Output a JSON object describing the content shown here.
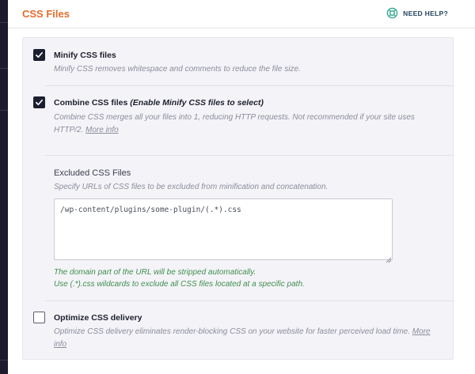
{
  "section": {
    "title": "CSS Files",
    "help_label": "NEED HELP?"
  },
  "colors": {
    "accent": "#e36b2c",
    "help": "#22465e",
    "note_green": "#3f8f4e",
    "checkbox": "#1b1f2f"
  },
  "options": {
    "minify": {
      "label": "Minify CSS files",
      "checked": true,
      "description": "Minify CSS removes whitespace and comments to reduce the file size."
    },
    "combine": {
      "label": "Combine CSS files",
      "hint": "(Enable Minify CSS files to select)",
      "checked": true,
      "description": "Combine CSS merges all your files into 1, reducing HTTP requests. Not recommended if your site uses HTTP/2.",
      "more_info": "More info"
    },
    "excluded": {
      "title": "Excluded CSS Files",
      "description": "Specify URLs of CSS files to be excluded from minification and concatenation.",
      "value": "/wp-content/plugins/some-plugin/(.*).css",
      "note_1": "The domain part of the URL will be stripped automatically.",
      "note_2": "Use (.*).css wildcards to exclude all CSS files located at a specific path."
    },
    "optimize": {
      "label": "Optimize CSS delivery",
      "checked": false,
      "description": "Optimize CSS delivery eliminates render-blocking CSS on your website for faster perceived load time.",
      "more_info": "More info"
    }
  },
  "icons": {
    "help": "lifebuoy-icon",
    "check": "checkmark-icon"
  }
}
